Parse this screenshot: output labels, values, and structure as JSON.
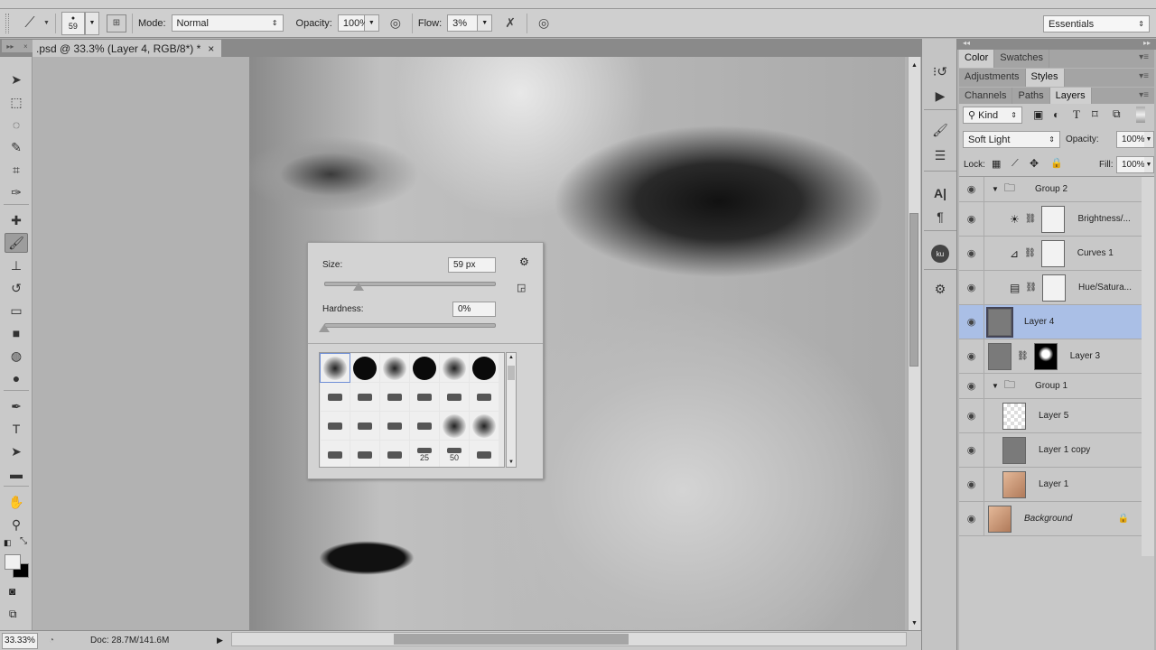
{
  "options_bar": {
    "brush_size": "59",
    "mode_label": "Mode:",
    "mode_value": "Normal",
    "opacity_label": "Opacity:",
    "opacity_value": "100%",
    "flow_label": "Flow:",
    "flow_value": "3%",
    "workspace": "Essentials"
  },
  "document": {
    "tab_title": ".psd @ 33.3% (Layer 4, RGB/8*) *",
    "close_glyph": "×"
  },
  "tools": [
    {
      "name": "move-tool",
      "glyph": "➤"
    },
    {
      "name": "marquee-tool",
      "glyph": "⬚"
    },
    {
      "name": "lasso-tool",
      "glyph": "◌"
    },
    {
      "name": "quick-selection-tool",
      "glyph": "✎"
    },
    {
      "name": "crop-tool",
      "glyph": "⌗"
    },
    {
      "name": "eyedropper-tool",
      "glyph": "✑"
    },
    {
      "name": "healing-brush-tool",
      "glyph": "✚"
    },
    {
      "name": "brush-tool",
      "glyph": "🖌"
    },
    {
      "name": "clone-stamp-tool",
      "glyph": "⊥"
    },
    {
      "name": "history-brush-tool",
      "glyph": "↺"
    },
    {
      "name": "eraser-tool",
      "glyph": "▭"
    },
    {
      "name": "gradient-tool",
      "glyph": "■"
    },
    {
      "name": "blur-tool",
      "glyph": "◍"
    },
    {
      "name": "dodge-tool",
      "glyph": "●"
    },
    {
      "name": "pen-tool",
      "glyph": "✒"
    },
    {
      "name": "type-tool",
      "glyph": "T"
    },
    {
      "name": "path-selection-tool",
      "glyph": "➤"
    },
    {
      "name": "rectangle-tool",
      "glyph": "▬"
    },
    {
      "name": "hand-tool",
      "glyph": "✋"
    },
    {
      "name": "zoom-tool",
      "glyph": "⚲"
    }
  ],
  "colors": {
    "foreground": "#f0f0f0",
    "background": "#000000",
    "accent": "#aabfe6"
  },
  "brush_popup": {
    "size_label": "Size:",
    "size_value": "59 px",
    "size_fraction": 0.2,
    "hardness_label": "Hardness:",
    "hardness_value": "0%",
    "hardness_fraction": 0.0,
    "presets": [
      {
        "type": "soft",
        "label": ""
      },
      {
        "type": "hard",
        "label": ""
      },
      {
        "type": "soft",
        "label": ""
      },
      {
        "type": "hard",
        "label": ""
      },
      {
        "type": "soft",
        "label": ""
      },
      {
        "type": "hard",
        "label": ""
      },
      {
        "type": "tip",
        "label": ""
      },
      {
        "type": "tip",
        "label": ""
      },
      {
        "type": "tip",
        "label": ""
      },
      {
        "type": "tip",
        "label": ""
      },
      {
        "type": "tip",
        "label": ""
      },
      {
        "type": "tip",
        "label": ""
      },
      {
        "type": "tip",
        "label": ""
      },
      {
        "type": "tip",
        "label": ""
      },
      {
        "type": "tip",
        "label": ""
      },
      {
        "type": "tip",
        "label": ""
      },
      {
        "type": "soft",
        "label": ""
      },
      {
        "type": "soft",
        "label": ""
      },
      {
        "type": "tip",
        "label": ""
      },
      {
        "type": "tip",
        "label": ""
      },
      {
        "type": "tip",
        "label": ""
      },
      {
        "type": "tip",
        "label": "25"
      },
      {
        "type": "tip",
        "label": "50"
      },
      {
        "type": "tip",
        "label": ""
      }
    ]
  },
  "status": {
    "zoom": "33.33%",
    "doc_info": "Doc: 28.7M/141.6M"
  },
  "panels": {
    "row1": [
      "Color",
      "Swatches"
    ],
    "row2": [
      "Adjustments",
      "Styles"
    ],
    "row3": [
      "Channels",
      "Paths",
      "Layers"
    ],
    "filter_kind": "Kind",
    "blend_mode": "Soft Light",
    "opacity_label": "Opacity:",
    "opacity_value": "100%",
    "lock_label": "Lock:",
    "fill_label": "Fill:",
    "fill_value": "100%"
  },
  "layers": [
    {
      "name": "Group 2",
      "kind": "group",
      "selected": false
    },
    {
      "name": "Brightness/...",
      "kind": "adjustment",
      "icon": "☀",
      "selected": false
    },
    {
      "name": "Curves 1",
      "kind": "adjustment",
      "icon": "⊿",
      "selected": false
    },
    {
      "name": "Hue/Satura...",
      "kind": "adjustment",
      "icon": "▤",
      "selected": false
    },
    {
      "name": "Layer 4",
      "kind": "layer",
      "selected": true
    },
    {
      "name": "Layer 3",
      "kind": "masked",
      "selected": false
    },
    {
      "name": "Group 1",
      "kind": "group",
      "selected": false
    },
    {
      "name": "Layer 5",
      "kind": "transparent",
      "selected": false
    },
    {
      "name": "Layer 1 copy",
      "kind": "gray",
      "selected": false
    },
    {
      "name": "Layer 1",
      "kind": "photo",
      "selected": false
    },
    {
      "name": "Background",
      "kind": "background",
      "selected": false,
      "locked": true
    }
  ]
}
